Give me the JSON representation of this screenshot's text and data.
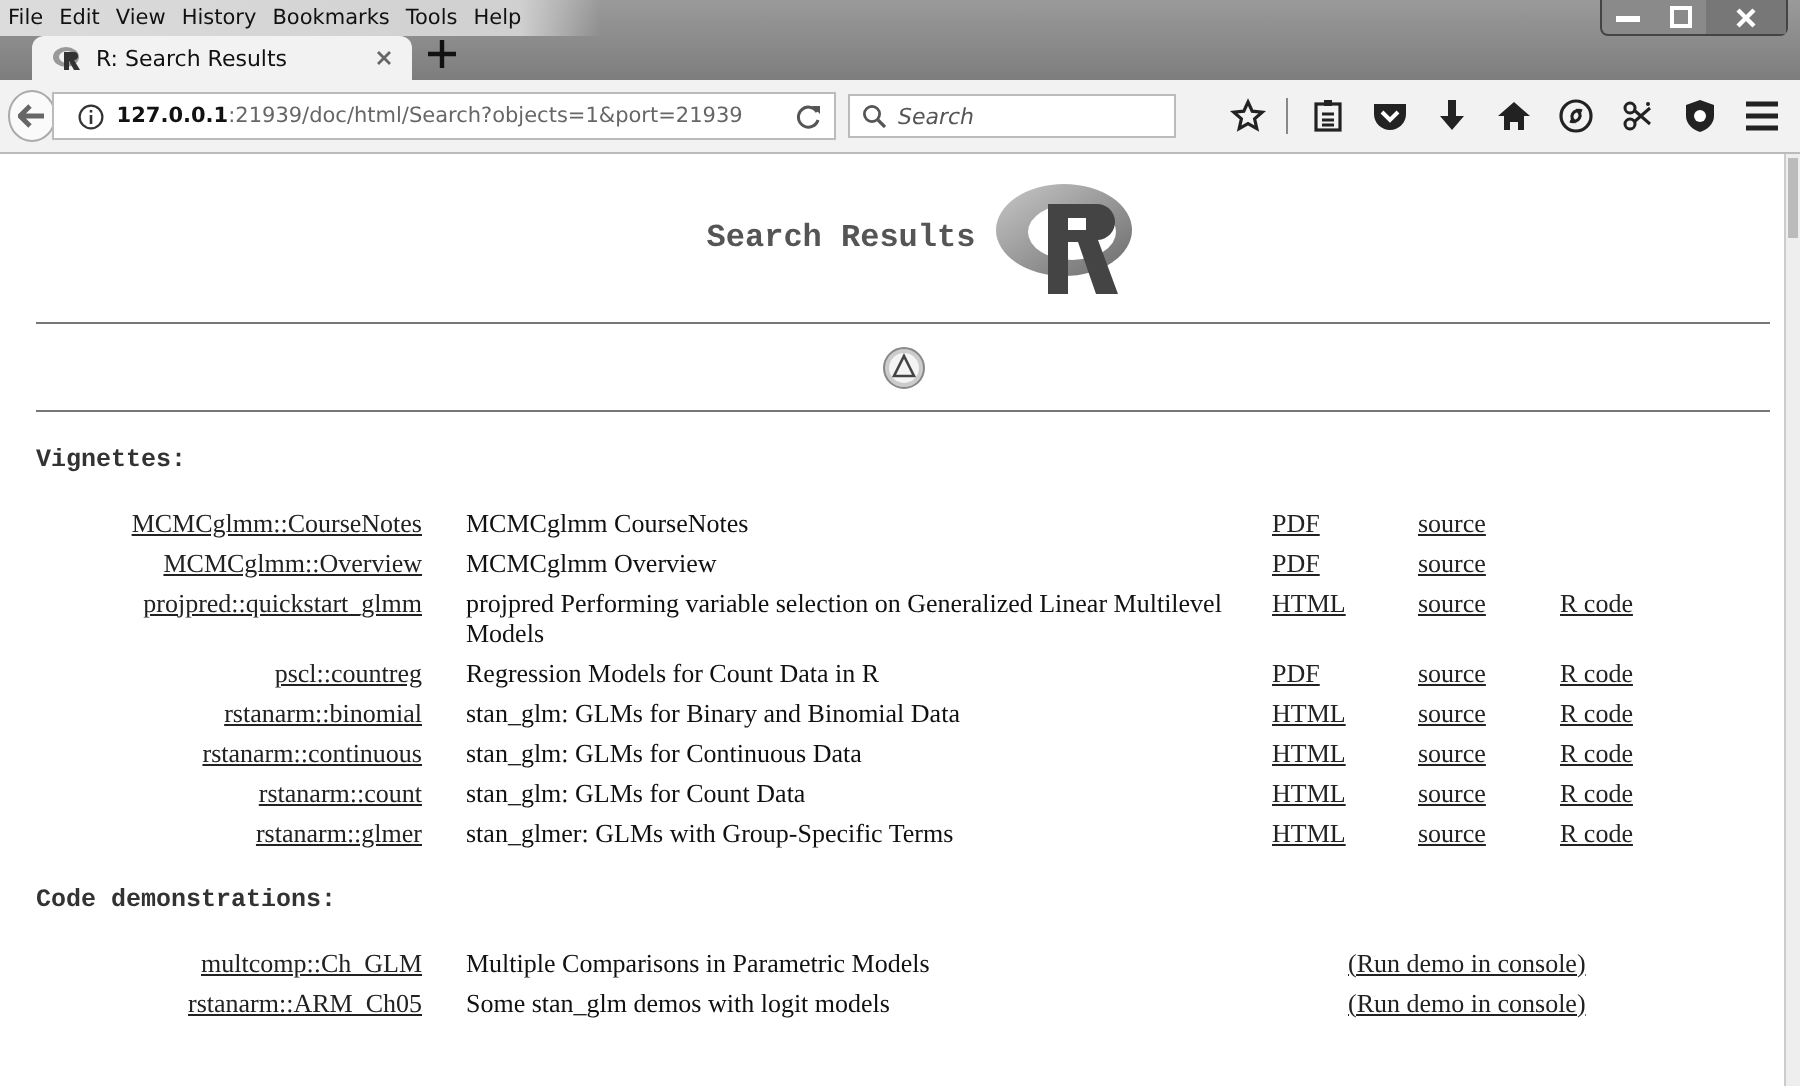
{
  "menu": [
    "File",
    "Edit",
    "View",
    "History",
    "Bookmarks",
    "Tools",
    "Help"
  ],
  "tabs": [
    {
      "label": "R: Search Results",
      "selected": true
    }
  ],
  "address": {
    "host": "127.0.0.1",
    "rest": ":21939/doc/html/Search?objects=1&port=21939"
  },
  "search": {
    "placeholder": "Search"
  },
  "page": {
    "title": "Search Results",
    "sections": [
      {
        "kind": "vignettes",
        "heading": "Vignettes:",
        "rows": [
          {
            "name": "MCMCglmm::CourseNotes",
            "title": "MCMCglmm CourseNotes",
            "doc": "PDF",
            "source": "source"
          },
          {
            "name": "MCMCglmm::Overview",
            "title": "MCMCglmm Overview",
            "doc": "PDF",
            "source": "source"
          },
          {
            "name": "projpred::quickstart_glmm",
            "title": "projpred Performing variable selection on Generalized Linear Multilevel Models",
            "doc": "HTML",
            "source": "source",
            "code": "R code"
          },
          {
            "name": "pscl::countreg",
            "title": "Regression Models for Count Data in R",
            "doc": "PDF",
            "source": "source",
            "code": "R code"
          },
          {
            "name": "rstanarm::binomial",
            "title": "stan_glm: GLMs for Binary and Binomial Data",
            "doc": "HTML",
            "source": "source",
            "code": "R code"
          },
          {
            "name": "rstanarm::continuous",
            "title": "stan_glm: GLMs for Continuous Data",
            "doc": "HTML",
            "source": "source",
            "code": "R code"
          },
          {
            "name": "rstanarm::count",
            "title": "stan_glm: GLMs for Count Data",
            "doc": "HTML",
            "source": "source",
            "code": "R code"
          },
          {
            "name": "rstanarm::glmer",
            "title": "stan_glmer: GLMs with Group-Specific Terms",
            "doc": "HTML",
            "source": "source",
            "code": "R code"
          }
        ]
      },
      {
        "kind": "demos",
        "heading": "Code demonstrations:",
        "rows": [
          {
            "name": "multcomp::Ch_GLM",
            "title": "Multiple Comparisons in Parametric Models",
            "action": "(Run demo in console)"
          },
          {
            "name": "rstanarm::ARM_Ch05",
            "title": "Some stan_glm demos with logit models",
            "action": "(Run demo in console)"
          }
        ]
      }
    ]
  }
}
